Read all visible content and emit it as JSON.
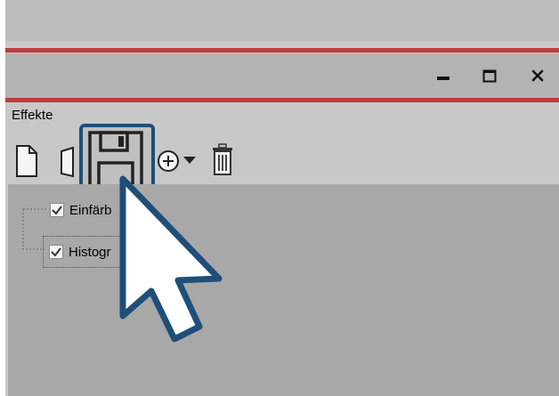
{
  "window": {
    "controls": {
      "minimize": "minimize",
      "maximize": "maximize",
      "close": "close"
    }
  },
  "panel": {
    "title": "Effekte",
    "toolbar": {
      "new_icon": "new-document-icon",
      "copy_icon": "copy-document-icon",
      "save_icon": "save-icon",
      "add_icon": "add-dropdown-icon",
      "delete_icon": "trash-icon"
    },
    "tree": {
      "items": [
        {
          "label": "Einfärb",
          "checked": true
        },
        {
          "label": "Histogr",
          "checked": true
        }
      ]
    }
  },
  "overlay": {
    "pointer": "mouse-cursor-icon"
  },
  "colors": {
    "accent_red": "#c03a3a",
    "highlight_border": "#1f4e78",
    "tree_background": "#a8a8a8"
  }
}
